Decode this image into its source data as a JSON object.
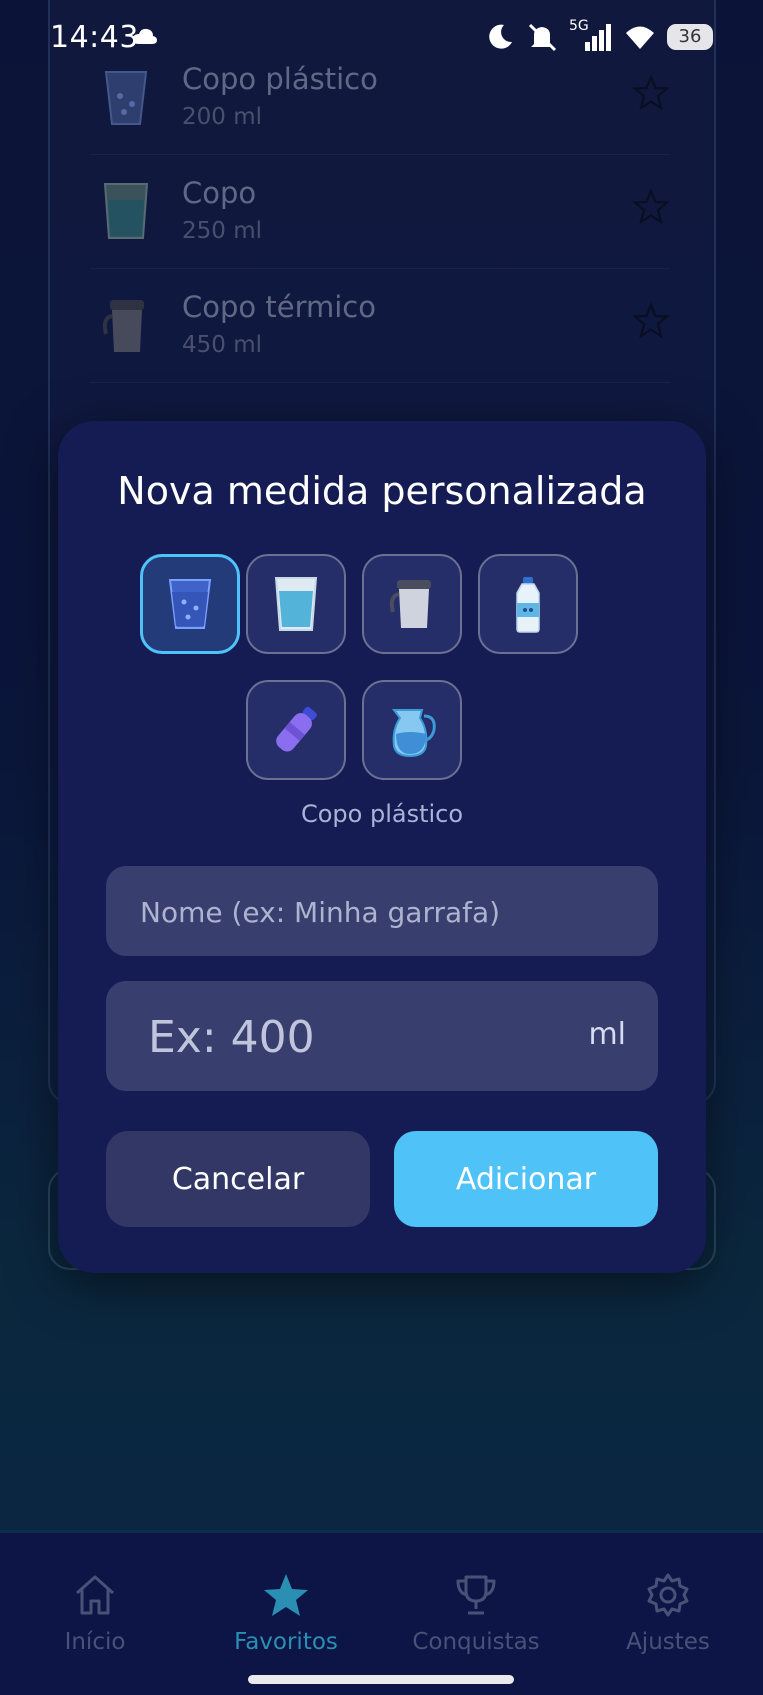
{
  "status_bar": {
    "time": "14:43",
    "network": "5G",
    "battery": "36"
  },
  "background_list": [
    {
      "name": "Copo plástico",
      "volume": "200 ml",
      "icon": "plastic-cup-icon"
    },
    {
      "name": "Copo",
      "volume": "250 ml",
      "icon": "glass-icon"
    },
    {
      "name": "Copo térmico",
      "volume": "450 ml",
      "icon": "thermal-cup-icon"
    }
  ],
  "dialog": {
    "title": "Nova medida personalizada",
    "icons": [
      {
        "name": "plastic-cup-icon",
        "selected": true
      },
      {
        "name": "glass-icon",
        "selected": false
      },
      {
        "name": "thermal-cup-icon",
        "selected": false
      },
      {
        "name": "water-bottle-icon",
        "selected": false
      },
      {
        "name": "sports-bottle-icon",
        "selected": false
      },
      {
        "name": "jug-icon",
        "selected": false
      }
    ],
    "selected_label": "Copo plástico",
    "name_placeholder": "Nome (ex: Minha garrafa)",
    "amount_placeholder": "Ex: 400",
    "unit": "ml",
    "cancel_label": "Cancelar",
    "add_label": "Adicionar"
  },
  "colors": {
    "accent": "#4fc3f7",
    "dialog_bg": "#151c54",
    "input_bg": "#383e6e"
  },
  "bottom_nav": [
    {
      "label": "Início",
      "icon": "home-icon",
      "active": false
    },
    {
      "label": "Favoritos",
      "icon": "star-icon",
      "active": true
    },
    {
      "label": "Conquistas",
      "icon": "trophy-icon",
      "active": false
    },
    {
      "label": "Ajustes",
      "icon": "gear-icon",
      "active": false
    }
  ]
}
